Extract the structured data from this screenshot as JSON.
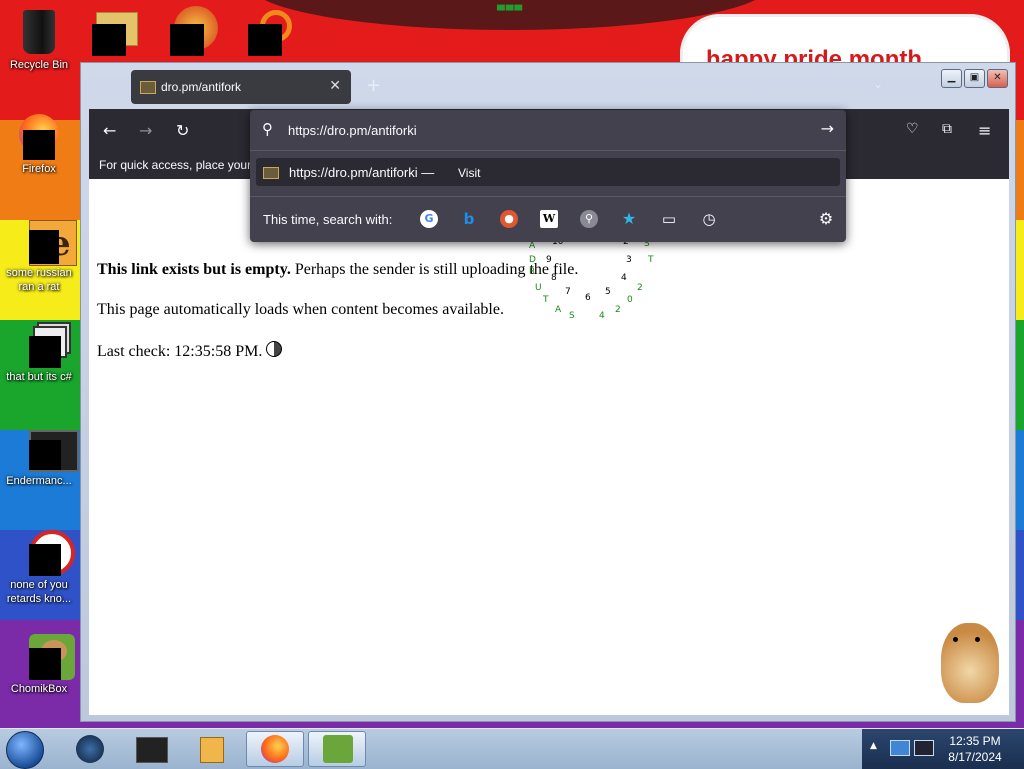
{
  "desktop": {
    "wall_text": "happy pride month",
    "icons": [
      {
        "label": "Recycle Bin"
      },
      {
        "label": "Firefox"
      },
      {
        "label": "some russian ran a rat"
      },
      {
        "label": "that but its c#"
      },
      {
        "label": "Endermanc..."
      },
      {
        "label": "none of you retards kno..."
      },
      {
        "label": "ChomikBox"
      }
    ]
  },
  "browser": {
    "tab_title": "dro.pm/antifork",
    "bookmarks_hint": "For quick access, place your b",
    "url_value": "https://dro.pm/antiforki",
    "suggestion_url": "https://dro.pm/antiforki",
    "suggestion_sep": "—",
    "suggestion_action": "Visit",
    "search_with_label": "This time, search with:",
    "engines": [
      "google-icon",
      "bing-icon",
      "duckduckgo-icon",
      "wikipedia-icon",
      "search-icon",
      "bookmarks-icon",
      "tabs-icon",
      "history-icon"
    ]
  },
  "page": {
    "bold_text": "This link exists but is empty.",
    "line1_rest": " Perhaps the sender is still uploading the file.",
    "line2": "This page automatically loads when content becomes available.",
    "line3": "Last check: 12:35:58 PM."
  },
  "taskbar": {
    "time": "12:35 PM",
    "date": "8/17/2024"
  },
  "colors": {
    "firefox_dark": "#2b2a33",
    "url_panel": "#42414d",
    "link_text": "#fbfbfe"
  }
}
